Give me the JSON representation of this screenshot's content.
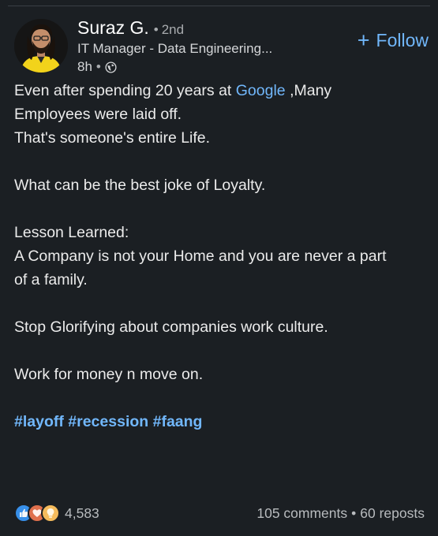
{
  "author": {
    "name": "Suraz G.",
    "degree": "2nd",
    "headline": "IT Manager - Data Engineering...",
    "time": "8h",
    "visibility_icon": "globe-icon",
    "avatar_icon": "profile-photo"
  },
  "follow": {
    "icon": "plus-icon",
    "label": "Follow"
  },
  "post": {
    "line1_prefix": "Even after spending 20 years at ",
    "line1_mention": "Google",
    "line1_suffix": " ,Many",
    "line2": "Employees were laid off.",
    "line3": "That's someone's entire Life.",
    "line4": "What can be the best joke of Loyalty.",
    "line5": "Lesson Learned:",
    "line6": "A Company is not your Home and  you are never a part",
    "line7": "of a family.",
    "line8": "Stop Glorifying about companies work culture.",
    "line9": "Work for money n move on.",
    "hashtags": [
      "#layoff",
      "#recession",
      "#faang"
    ]
  },
  "social": {
    "reaction_icons": [
      "like-icon",
      "love-icon",
      "insightful-icon"
    ],
    "reaction_count": "4,583",
    "comments": "105 comments",
    "reposts": "60 reposts"
  },
  "colors": {
    "background": "#1b1f23",
    "link": "#71b7fb",
    "text": "#ebebeb",
    "muted": "#a8abae"
  }
}
